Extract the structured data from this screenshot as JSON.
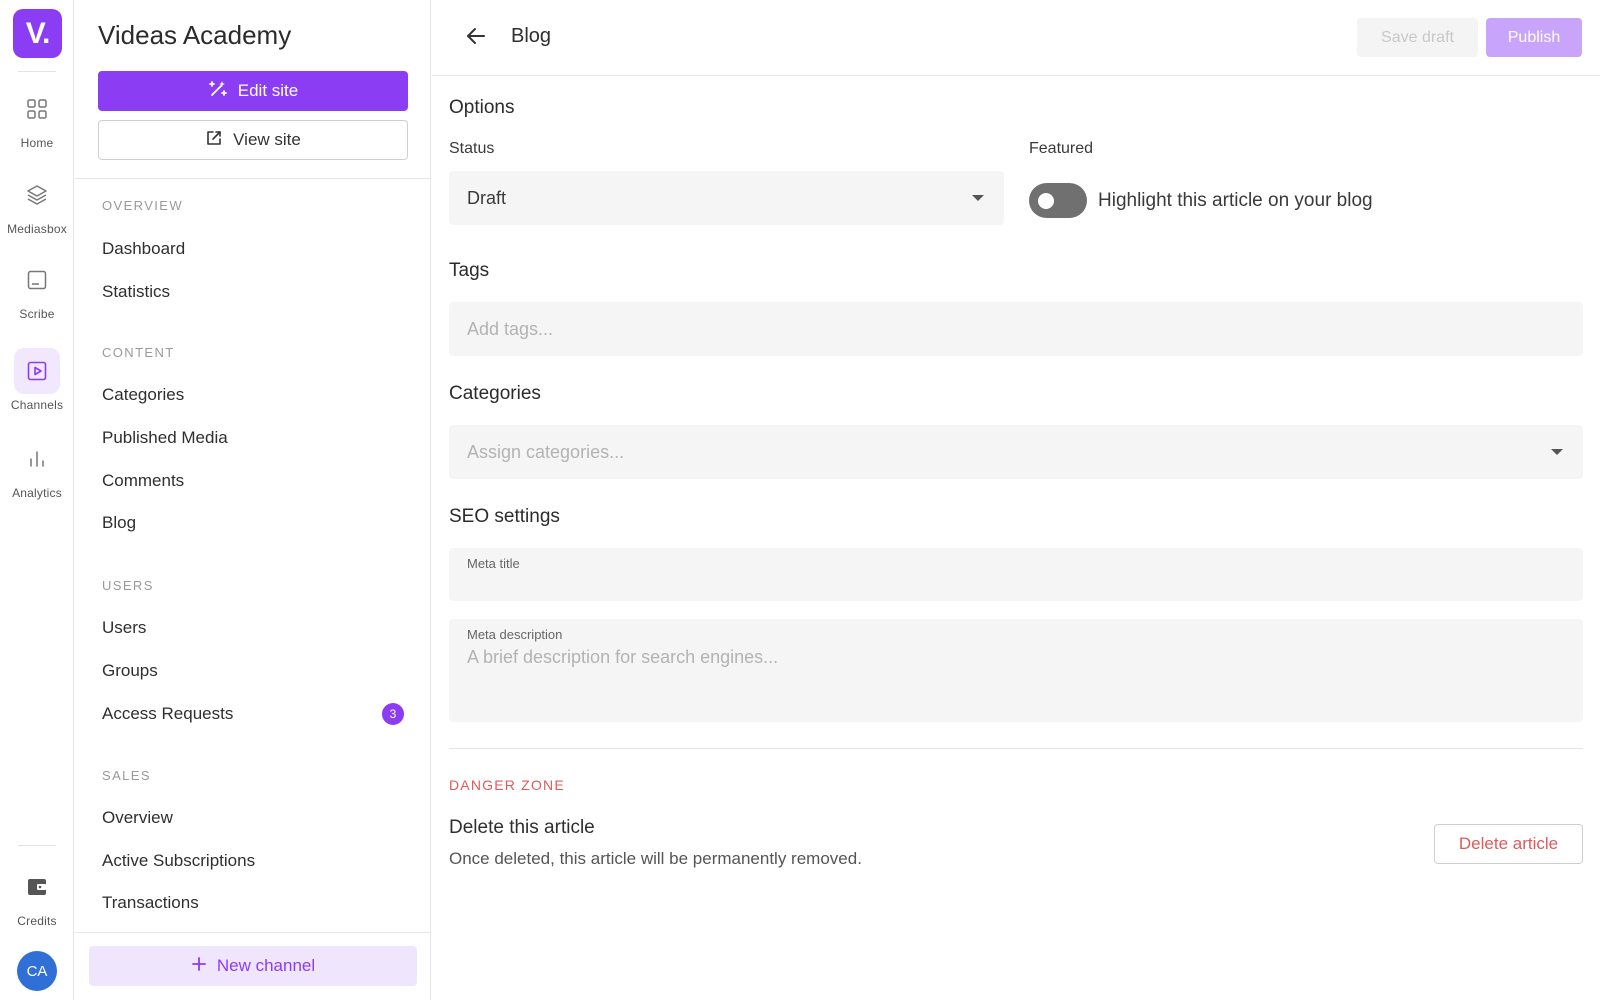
{
  "rail": {
    "logo_text": "V.",
    "items": [
      {
        "label": "Home",
        "icon": "grid-icon"
      },
      {
        "label": "Mediasbox",
        "icon": "layers-icon"
      },
      {
        "label": "Scribe",
        "icon": "document-icon"
      },
      {
        "label": "Channels",
        "icon": "play-icon"
      },
      {
        "label": "Analytics",
        "icon": "bar-chart-icon"
      }
    ],
    "credits_label": "Credits",
    "avatar_initials": "CA",
    "active_item": "Channels",
    "accent_color": "#8b3df4"
  },
  "sidebar": {
    "site_title": "Videas Academy",
    "edit_site_label": "Edit site",
    "view_site_label": "View site",
    "sections": [
      {
        "heading": "OVERVIEW",
        "items": [
          {
            "label": "Dashboard"
          },
          {
            "label": "Statistics"
          }
        ]
      },
      {
        "heading": "CONTENT",
        "items": [
          {
            "label": "Categories"
          },
          {
            "label": "Published Media"
          },
          {
            "label": "Comments"
          },
          {
            "label": "Blog"
          }
        ]
      },
      {
        "heading": "USERS",
        "items": [
          {
            "label": "Users"
          },
          {
            "label": "Groups"
          },
          {
            "label": "Access Requests",
            "badge": "3"
          }
        ]
      },
      {
        "heading": "SALES",
        "items": [
          {
            "label": "Overview"
          },
          {
            "label": "Active Subscriptions"
          },
          {
            "label": "Transactions"
          }
        ]
      }
    ],
    "new_channel_label": "New channel"
  },
  "header": {
    "title": "Blog",
    "save_draft_label": "Save draft",
    "publish_label": "Publish"
  },
  "options": {
    "heading": "Options",
    "status_label": "Status",
    "status_value": "Draft",
    "featured_label": "Featured",
    "featured_toggle_label": "Highlight this article on your blog",
    "featured_on": false
  },
  "tags": {
    "heading": "Tags",
    "placeholder": "Add tags..."
  },
  "categories": {
    "heading": "Categories",
    "placeholder": "Assign categories..."
  },
  "seo": {
    "heading": "SEO settings",
    "meta_title_label": "Meta title",
    "meta_description_label": "Meta description",
    "meta_description_placeholder": "A brief description for search engines..."
  },
  "danger": {
    "heading": "DANGER ZONE",
    "title": "Delete this article",
    "description": "Once deleted, this article will be permanently removed.",
    "delete_label": "Delete article",
    "danger_color": "#e05a5a"
  }
}
